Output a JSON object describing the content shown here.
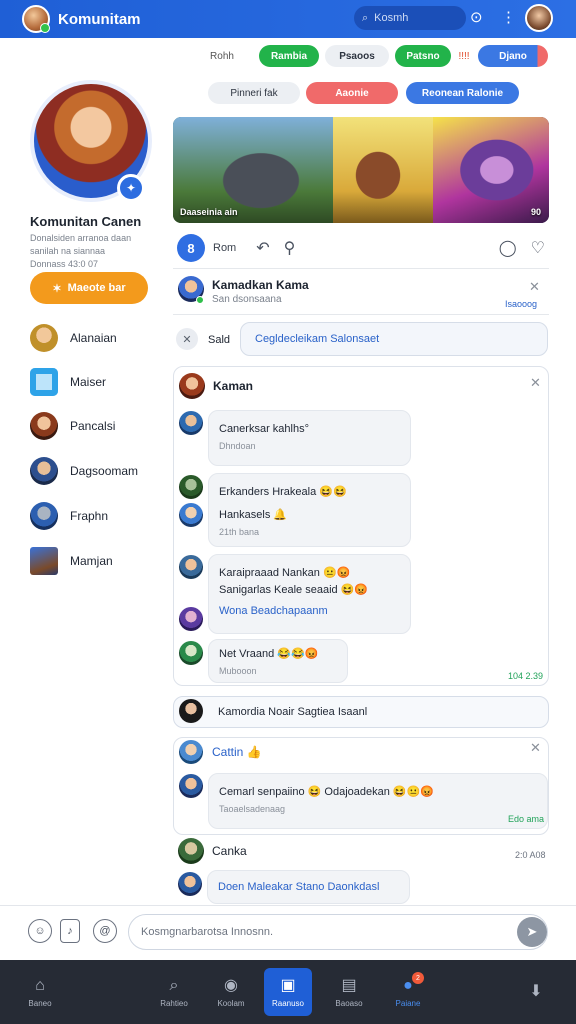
{
  "app": {
    "title": "Komunitam"
  },
  "search": {
    "placeholder": "Kosmh"
  },
  "filters": {
    "row1": [
      "Rohh",
      "Rambia",
      "Psaoos",
      "Patsno",
      "!!!!",
      "Djano"
    ],
    "row2": [
      "Pinneri fak",
      "Aaonie",
      "Reonean Ralonie"
    ]
  },
  "profile": {
    "name": "Komunitan Canen",
    "subtitle": "Donalsiden arranoa daan sanilah na siannaa",
    "meta": "Donnass 43:0 07",
    "cta_label": "Maeote bar"
  },
  "sidebar": {
    "items": [
      {
        "label": "Alanaian",
        "icon": "avatar-icon"
      },
      {
        "label": "Maiser",
        "icon": "chat-square-icon"
      },
      {
        "label": "Pancalsi",
        "icon": "avatar-icon"
      },
      {
        "label": "Dagsoomam",
        "icon": "avatar-icon"
      },
      {
        "label": "Fraphn",
        "icon": "avatar-icon"
      },
      {
        "label": "Mamjan",
        "icon": "avatar-icon"
      }
    ]
  },
  "banner": {
    "caption": "Daaseinia ain",
    "caption_right": "90"
  },
  "actions": {
    "badge": "8",
    "label": "Rom"
  },
  "notification": {
    "title": "Kamadkan Kama",
    "sub": "San dsonsaana",
    "time": "Isaooog"
  },
  "reply": {
    "label": "Sald",
    "input": "Cegldecleikam Salonsaet"
  },
  "thread": {
    "title": "Kaman",
    "messages": [
      {
        "line1": "Canerksar kahlhs°",
        "line2": "Dhndoan"
      },
      {
        "line1": "Erkanders Hrakeala 😆😆",
        "line2": ""
      },
      {
        "line1": "Hankasels 🔔",
        "line2": "21th bana"
      },
      {
        "line1": "Karaipraaad Nankan 😐😡",
        "line2": "Sanigarlas Keale seaaid 😆😡"
      },
      {
        "line1": "Wona Beadchapaanm",
        "line2": ""
      },
      {
        "line1": "Net Vraand 😂😂😡",
        "line2": "Mubooon"
      }
    ],
    "time": "104 2.39"
  },
  "announcement": {
    "text": "Kamordia Noair Sagtiea Isaanl"
  },
  "thread2": {
    "title": "Cattin 👍",
    "message_line1": "Cemarl senpaiino 😆 Odajoadekan 😆😐😡",
    "message_line2": "Taoaelsadenaag",
    "time": "Edo ama"
  },
  "thread3": {
    "title": "Canka",
    "time": "2:0 A08",
    "message": "Doen Maleakar Stano Daonkdasl"
  },
  "composer": {
    "placeholder": "Kosmgnarbarotsa Innosnn."
  },
  "bottom_nav": {
    "items": [
      {
        "label": "Baneo",
        "icon": "home-icon"
      },
      {
        "label": "Rahtieo",
        "icon": "search-icon"
      },
      {
        "label": "Koolam",
        "icon": "camera-icon"
      },
      {
        "label": "Raanuso",
        "icon": "community-icon"
      },
      {
        "label": "Baoaso",
        "icon": "gallery-icon"
      },
      {
        "label": "Paiane",
        "icon": "profile-icon",
        "badge": "2"
      },
      {
        "label": "",
        "icon": "download-icon"
      }
    ]
  },
  "colors": {
    "brand": "#1f5fd6",
    "accent": "#f39a1c",
    "success": "#22b34a",
    "danger": "#f06a6a"
  }
}
